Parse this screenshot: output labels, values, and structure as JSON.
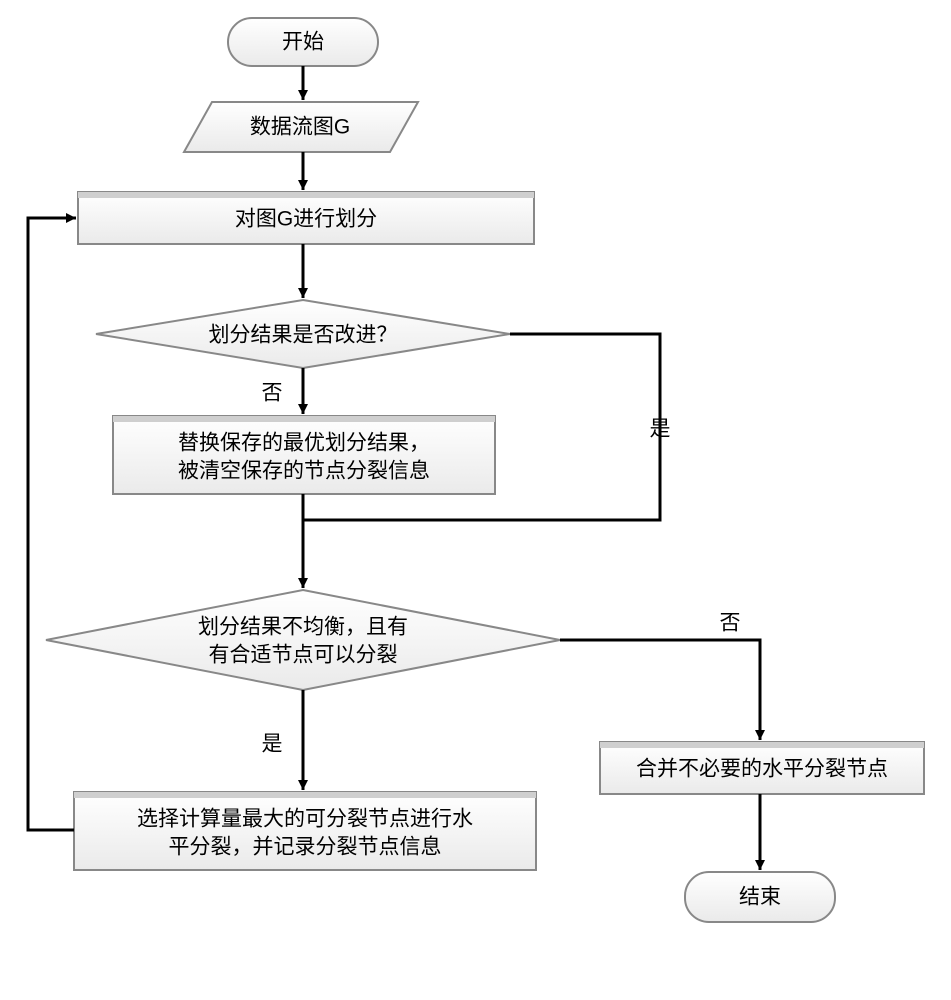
{
  "chart_data": {
    "type": "flowchart",
    "nodes": [
      {
        "id": "start",
        "shape": "terminator",
        "text": "开始"
      },
      {
        "id": "input",
        "shape": "parallelogram",
        "text": "数据流图G"
      },
      {
        "id": "partition",
        "shape": "process",
        "text": "对图G进行划分"
      },
      {
        "id": "improved",
        "shape": "decision",
        "text": "划分结果是否改进？"
      },
      {
        "id": "replace",
        "shape": "process",
        "text": "替换保存的最优划分结果，\n被清空保存的节点分裂信息"
      },
      {
        "id": "unbalanced",
        "shape": "decision",
        "text": "划分结果不均衡，且有\n有合适节点可以分裂"
      },
      {
        "id": "split",
        "shape": "process",
        "text": "选择计算量最大的可分裂节点进行水\n平分裂，并记录分裂节点信息"
      },
      {
        "id": "merge",
        "shape": "process",
        "text": "合并不必要的水平分裂节点"
      },
      {
        "id": "end",
        "shape": "terminator",
        "text": "结束"
      }
    ],
    "edges": [
      {
        "from": "start",
        "to": "input"
      },
      {
        "from": "input",
        "to": "partition"
      },
      {
        "from": "partition",
        "to": "improved"
      },
      {
        "from": "improved",
        "to": "replace",
        "label": "否"
      },
      {
        "from": "improved",
        "to": "unbalanced",
        "label": "是"
      },
      {
        "from": "replace",
        "to": "unbalanced"
      },
      {
        "from": "unbalanced",
        "to": "split",
        "label": "是"
      },
      {
        "from": "unbalanced",
        "to": "merge",
        "label": "否"
      },
      {
        "from": "split",
        "to": "partition"
      },
      {
        "from": "merge",
        "to": "end"
      }
    ]
  },
  "n": {
    "start": "开始",
    "input": "数据流图G",
    "partition": "对图G进行划分",
    "improved": "划分结果是否改进？",
    "replace_l1": "替换保存的最优划分结果，",
    "replace_l2": "被清空保存的节点分裂信息",
    "unbalanced_l1": "划分结果不均衡，且有",
    "unbalanced_l2": "有合适节点可以分裂",
    "split_l1": "选择计算量最大的可分裂节点进行水",
    "split_l2": "平分裂，并记录分裂节点信息",
    "merge": "合并不必要的水平分裂节点",
    "end": "结束"
  },
  "labels": {
    "yes": "是",
    "no": "否"
  }
}
